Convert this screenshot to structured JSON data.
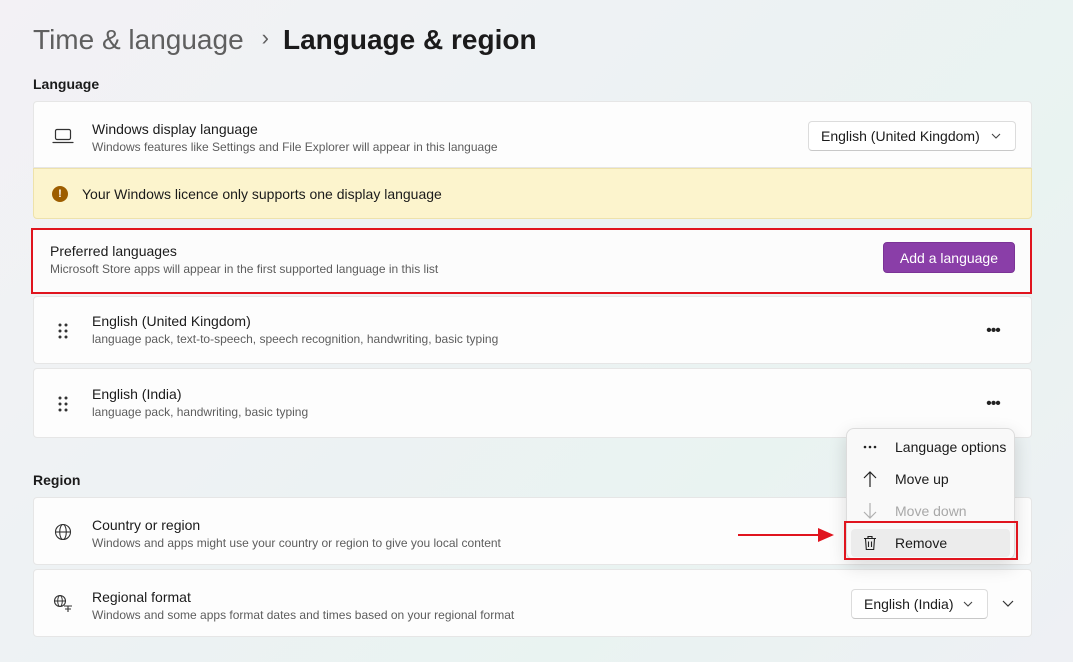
{
  "breadcrumb": {
    "parent": "Time & language",
    "separator": "›",
    "current": "Language & region"
  },
  "language_section": {
    "title": "Language",
    "display_language": {
      "title": "Windows display language",
      "subtitle": "Windows features like Settings and File Explorer will appear in this language",
      "selected": "English (United Kingdom)"
    },
    "warning": {
      "icon_glyph": "!",
      "text": "Your Windows licence only supports one display language"
    },
    "preferred": {
      "title": "Preferred languages",
      "subtitle": "Microsoft Store apps will appear in the first supported language in this list",
      "add_button": "Add a language"
    },
    "languages": [
      {
        "name": "English (United Kingdom)",
        "features": "language pack, text-to-speech, speech recognition, handwriting, basic typing"
      },
      {
        "name": "English (India)",
        "features": "language pack, handwriting, basic typing"
      }
    ],
    "more_glyph": "•••"
  },
  "context_menu": {
    "items": [
      {
        "label": "Language options",
        "icon": "more-icon",
        "disabled": false
      },
      {
        "label": "Move up",
        "icon": "arrow-up-icon",
        "disabled": false
      },
      {
        "label": "Move down",
        "icon": "arrow-down-icon",
        "disabled": true
      },
      {
        "label": "Remove",
        "icon": "trash-icon",
        "disabled": false
      }
    ]
  },
  "region_section": {
    "title": "Region",
    "country": {
      "title": "Country or region",
      "subtitle": "Windows and apps might use your country or region to give you local content"
    },
    "regional_format": {
      "title": "Regional format",
      "subtitle": "Windows and some apps format dates and times based on your regional format",
      "selected": "English (India)"
    }
  },
  "colors": {
    "accent": "#8a3ea8",
    "highlight": "#e0141e",
    "warning_bg": "#fcf4cd",
    "warning_icon": "#9d5d00"
  }
}
